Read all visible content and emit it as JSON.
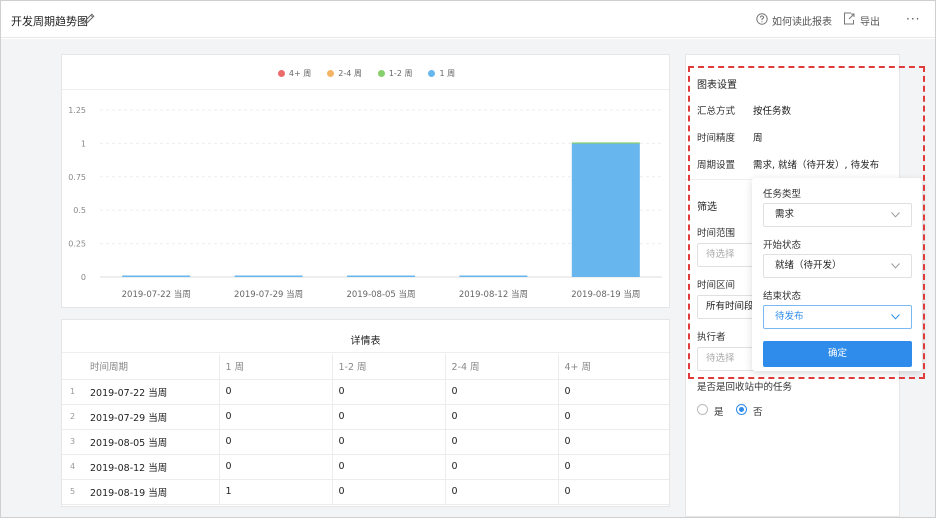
{
  "header": {
    "title": "开发周期趋势图",
    "help_label": "如何读此报表",
    "export_label": "导出",
    "more_label": "···"
  },
  "chart_data": {
    "type": "bar",
    "stacked": true,
    "categories": [
      "2019-07-22 当周",
      "2019-07-29 当周",
      "2019-08-05 当周",
      "2019-08-12 当周",
      "2019-08-19 当周"
    ],
    "series": [
      {
        "name": "4+ 周",
        "color": "#ec6b6b",
        "values": [
          0,
          0,
          0,
          0,
          0
        ]
      },
      {
        "name": "2-4 周",
        "color": "#f5b465",
        "values": [
          0,
          0,
          0,
          0,
          0
        ]
      },
      {
        "name": "1-2 周",
        "color": "#86cf6c",
        "values": [
          0,
          0,
          0,
          0,
          0
        ]
      },
      {
        "name": "1 周",
        "color": "#67b6ee",
        "values": [
          0,
          0,
          0,
          0,
          1
        ]
      }
    ],
    "yticks": [
      "1.25",
      "1",
      "0.75",
      "0.5",
      "0.25",
      "0"
    ],
    "ylim": [
      0,
      1.25
    ],
    "legend_position": "top-center",
    "grid": true
  },
  "table": {
    "title": "详情表",
    "columns": [
      "时间周期",
      "1 周",
      "1-2 周",
      "2-4 周",
      "4+ 周"
    ],
    "rows": [
      {
        "index": "1",
        "cells": [
          "2019-07-22 当周",
          "0",
          "0",
          "0",
          "0"
        ]
      },
      {
        "index": "2",
        "cells": [
          "2019-07-29 当周",
          "0",
          "0",
          "0",
          "0"
        ]
      },
      {
        "index": "3",
        "cells": [
          "2019-08-05 当周",
          "0",
          "0",
          "0",
          "0"
        ]
      },
      {
        "index": "4",
        "cells": [
          "2019-08-12 当周",
          "0",
          "0",
          "0",
          "0"
        ]
      },
      {
        "index": "5",
        "cells": [
          "2019-08-19 当周",
          "1",
          "0",
          "0",
          "0"
        ]
      }
    ]
  },
  "settings": {
    "heading": "图表设置",
    "summary_label": "汇总方式",
    "summary_value": "按任务数",
    "granularity_label": "时间精度",
    "granularity_value": "周",
    "cycle_label": "周期设置",
    "cycle_value": "需求, 就绪（待开发）, 待发布",
    "filter_heading": "筛选",
    "time_range_label": "时间范围",
    "time_range_placeholder": "待选择",
    "time_interval_label": "时间区间",
    "time_interval_value": "所有时间段",
    "assignee_label": "执行者",
    "assignee_placeholder": "待选择",
    "recycle_label": "是否是回收站中的任务",
    "option_yes": "是",
    "option_no": "否",
    "selected_option": "否"
  },
  "popover": {
    "task_type_label": "任务类型",
    "task_type_value": "需求",
    "start_status_label": "开始状态",
    "start_status_value": "就绪（待开发）",
    "end_status_label": "结束状态",
    "end_status_value": "待发布",
    "confirm_label": "确定"
  },
  "colors": {
    "accent": "#2f8ceb",
    "highlight_border": "#e03b3b"
  }
}
